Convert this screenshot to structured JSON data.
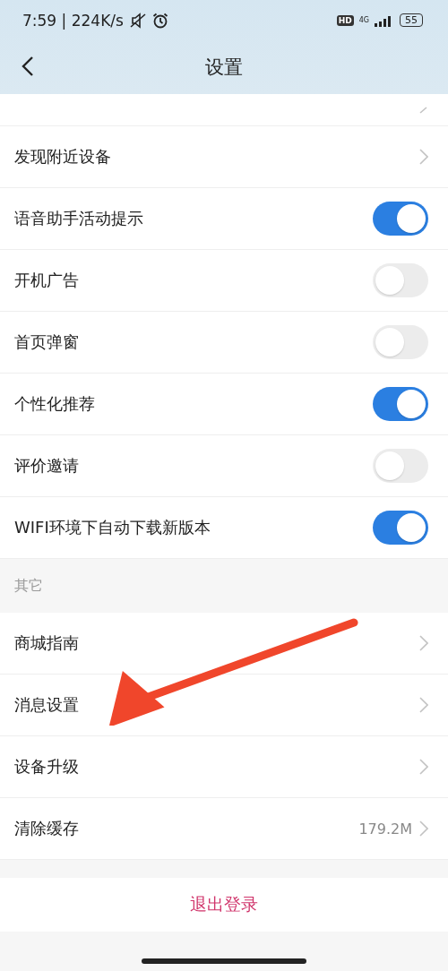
{
  "status_bar": {
    "time": "7:59 | 224K/s",
    "hd": "HD",
    "network": "4G",
    "battery": "55"
  },
  "header": {
    "title": "设置"
  },
  "sections": [
    {
      "items": [
        {
          "kind": "stub"
        },
        {
          "kind": "link",
          "label": "发现附近设备"
        },
        {
          "kind": "toggle",
          "label": "语音助手活动提示",
          "on": true
        },
        {
          "kind": "toggle",
          "label": "开机广告",
          "on": false
        },
        {
          "kind": "toggle",
          "label": "首页弹窗",
          "on": false
        },
        {
          "kind": "toggle",
          "label": "个性化推荐",
          "on": true
        },
        {
          "kind": "toggle",
          "label": "评价邀请",
          "on": false
        },
        {
          "kind": "toggle",
          "label": "WIFI环境下自动下载新版本",
          "on": true
        }
      ]
    },
    {
      "title": "其它",
      "items": [
        {
          "kind": "link",
          "label": "商城指南"
        },
        {
          "kind": "link",
          "label": "消息设置"
        },
        {
          "kind": "link",
          "label": "设备升级"
        },
        {
          "kind": "link",
          "label": "清除缓存",
          "value": "179.2M"
        }
      ]
    }
  ],
  "logout": "退出登录"
}
